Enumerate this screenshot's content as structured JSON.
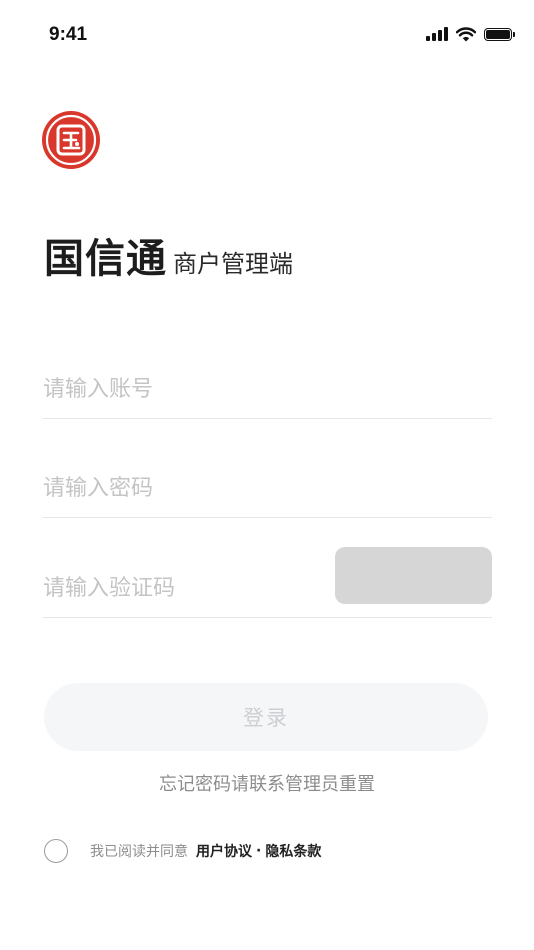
{
  "status_bar": {
    "time": "9:41"
  },
  "brand": {
    "name": "国信通",
    "subtitle": "商户管理端",
    "logo_color": "#d9372b"
  },
  "form": {
    "account_placeholder": "请输入账号",
    "password_placeholder": "请输入密码",
    "captcha_placeholder": "请输入验证码"
  },
  "actions": {
    "login_label": "登录",
    "forgot_text": "忘记密码请联系管理员重置"
  },
  "agreement": {
    "prefix": "我已阅读并同意",
    "user_agreement": "用户协议",
    "separator": "·",
    "privacy_policy": "隐私条款"
  }
}
